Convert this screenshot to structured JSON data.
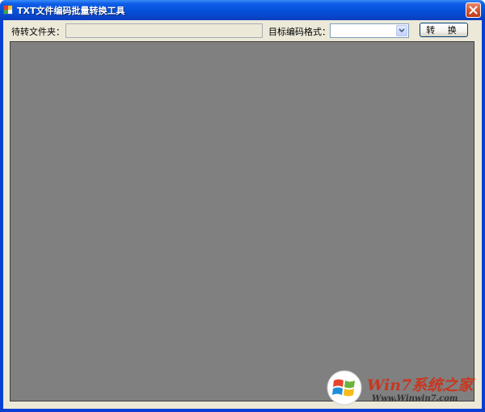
{
  "window": {
    "title": "TXT文件编码批量转换工具",
    "close_icon": "close-icon",
    "title_bar_color": "#0450d9"
  },
  "toolbar": {
    "folder_label": "待转文件夹：",
    "folder_value": "",
    "format_label": "目标编码格式：",
    "format_selected": "",
    "convert_label": "转 换"
  },
  "log_panel": {
    "background": "#808080"
  },
  "watermark": {
    "brand": "Win7系统之家",
    "url": "Www.Winwin7.com"
  }
}
